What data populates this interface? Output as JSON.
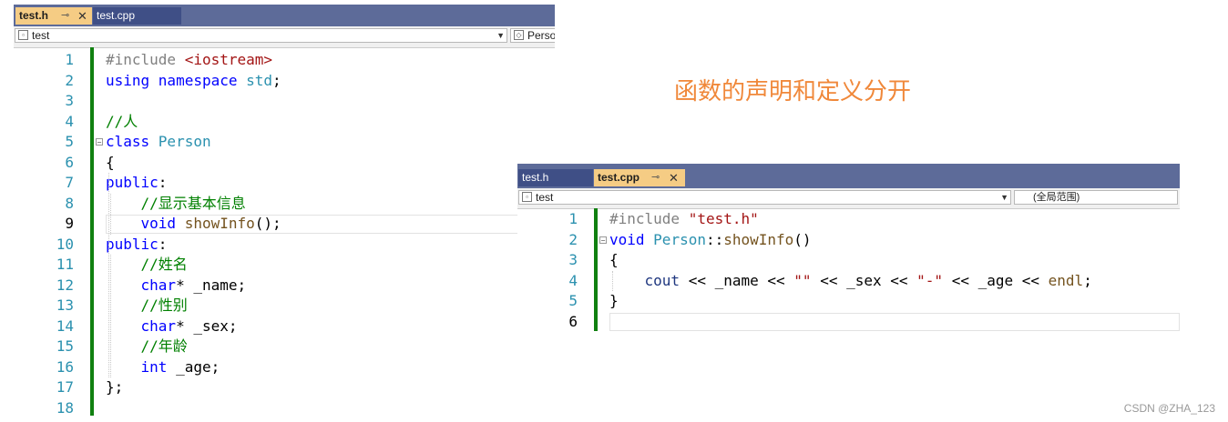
{
  "caption": "函数的声明和定义分开",
  "watermark": "CSDN @ZHA_123",
  "left_editor": {
    "tabs": [
      {
        "label": "test.h",
        "active": true
      },
      {
        "label": "test.cpp",
        "active": false
      }
    ],
    "nav": {
      "scope": "test",
      "member": "Perso"
    },
    "lines": [
      {
        "num": "1",
        "tokens": [
          {
            "t": "#include ",
            "c": "pp"
          },
          {
            "t": "<iostream>",
            "c": "st"
          }
        ]
      },
      {
        "num": "2",
        "tokens": [
          {
            "t": "using namespace ",
            "c": "kw"
          },
          {
            "t": "std",
            "c": "ty"
          },
          {
            "t": ";",
            "c": ""
          }
        ]
      },
      {
        "num": "3",
        "tokens": []
      },
      {
        "num": "4",
        "tokens": [
          {
            "t": "//人",
            "c": "cm"
          }
        ]
      },
      {
        "num": "5",
        "tokens": [
          {
            "t": "class ",
            "c": "kw"
          },
          {
            "t": "Person",
            "c": "ty"
          }
        ]
      },
      {
        "num": "6",
        "tokens": [
          {
            "t": "{",
            "c": ""
          }
        ]
      },
      {
        "num": "7",
        "tokens": [
          {
            "t": "public",
            "c": "kw"
          },
          {
            "t": ":",
            "c": ""
          }
        ]
      },
      {
        "num": "8",
        "tokens": [
          {
            "t": "    ",
            "c": ""
          },
          {
            "t": "//显示基本信息",
            "c": "cm"
          }
        ]
      },
      {
        "num": "9",
        "tokens": [
          {
            "t": "    ",
            "c": ""
          },
          {
            "t": "void ",
            "c": "kw"
          },
          {
            "t": "showInfo",
            "c": "fn"
          },
          {
            "t": "();",
            "c": ""
          }
        ]
      },
      {
        "num": "10",
        "tokens": [
          {
            "t": "public",
            "c": "kw"
          },
          {
            "t": ":",
            "c": ""
          }
        ]
      },
      {
        "num": "11",
        "tokens": [
          {
            "t": "    ",
            "c": ""
          },
          {
            "t": "//姓名",
            "c": "cm"
          }
        ]
      },
      {
        "num": "12",
        "tokens": [
          {
            "t": "    ",
            "c": ""
          },
          {
            "t": "char",
            "c": "kw"
          },
          {
            "t": "* _name;",
            "c": ""
          }
        ]
      },
      {
        "num": "13",
        "tokens": [
          {
            "t": "    ",
            "c": ""
          },
          {
            "t": "//性别",
            "c": "cm"
          }
        ]
      },
      {
        "num": "14",
        "tokens": [
          {
            "t": "    ",
            "c": ""
          },
          {
            "t": "char",
            "c": "kw"
          },
          {
            "t": "* _sex;",
            "c": ""
          }
        ]
      },
      {
        "num": "15",
        "tokens": [
          {
            "t": "    ",
            "c": ""
          },
          {
            "t": "//年龄",
            "c": "cm"
          }
        ]
      },
      {
        "num": "16",
        "tokens": [
          {
            "t": "    ",
            "c": ""
          },
          {
            "t": "int ",
            "c": "kw"
          },
          {
            "t": "_age;",
            "c": ""
          }
        ]
      },
      {
        "num": "17",
        "tokens": [
          {
            "t": "};",
            "c": ""
          }
        ]
      },
      {
        "num": "18",
        "tokens": []
      }
    ],
    "current_line": 9
  },
  "right_editor": {
    "tabs": [
      {
        "label": "test.h",
        "active": false
      },
      {
        "label": "test.cpp",
        "active": true
      }
    ],
    "nav": {
      "scope": "test",
      "member": "(全局范围)"
    },
    "lines": [
      {
        "num": "1",
        "tokens": [
          {
            "t": "#include ",
            "c": "pp"
          },
          {
            "t": "\"test.h\"",
            "c": "st"
          }
        ]
      },
      {
        "num": "2",
        "tokens": [
          {
            "t": "void ",
            "c": "kw"
          },
          {
            "t": "Person",
            "c": "ty"
          },
          {
            "t": "::",
            "c": ""
          },
          {
            "t": "showInfo",
            "c": "fn"
          },
          {
            "t": "()",
            "c": ""
          }
        ]
      },
      {
        "num": "3",
        "tokens": [
          {
            "t": "{",
            "c": ""
          }
        ]
      },
      {
        "num": "4",
        "tokens": [
          {
            "t": "    ",
            "c": ""
          },
          {
            "t": "cout",
            "c": "vr"
          },
          {
            "t": " << _name << ",
            "c": ""
          },
          {
            "t": "\"\"",
            "c": "st"
          },
          {
            "t": " << _sex << ",
            "c": ""
          },
          {
            "t": "\"-\"",
            "c": "st"
          },
          {
            "t": " << _age << ",
            "c": ""
          },
          {
            "t": "endl",
            "c": "fn"
          },
          {
            "t": ";",
            "c": ""
          }
        ]
      },
      {
        "num": "5",
        "tokens": [
          {
            "t": "}",
            "c": ""
          }
        ]
      },
      {
        "num": "6",
        "tokens": []
      }
    ],
    "current_line": 6
  }
}
